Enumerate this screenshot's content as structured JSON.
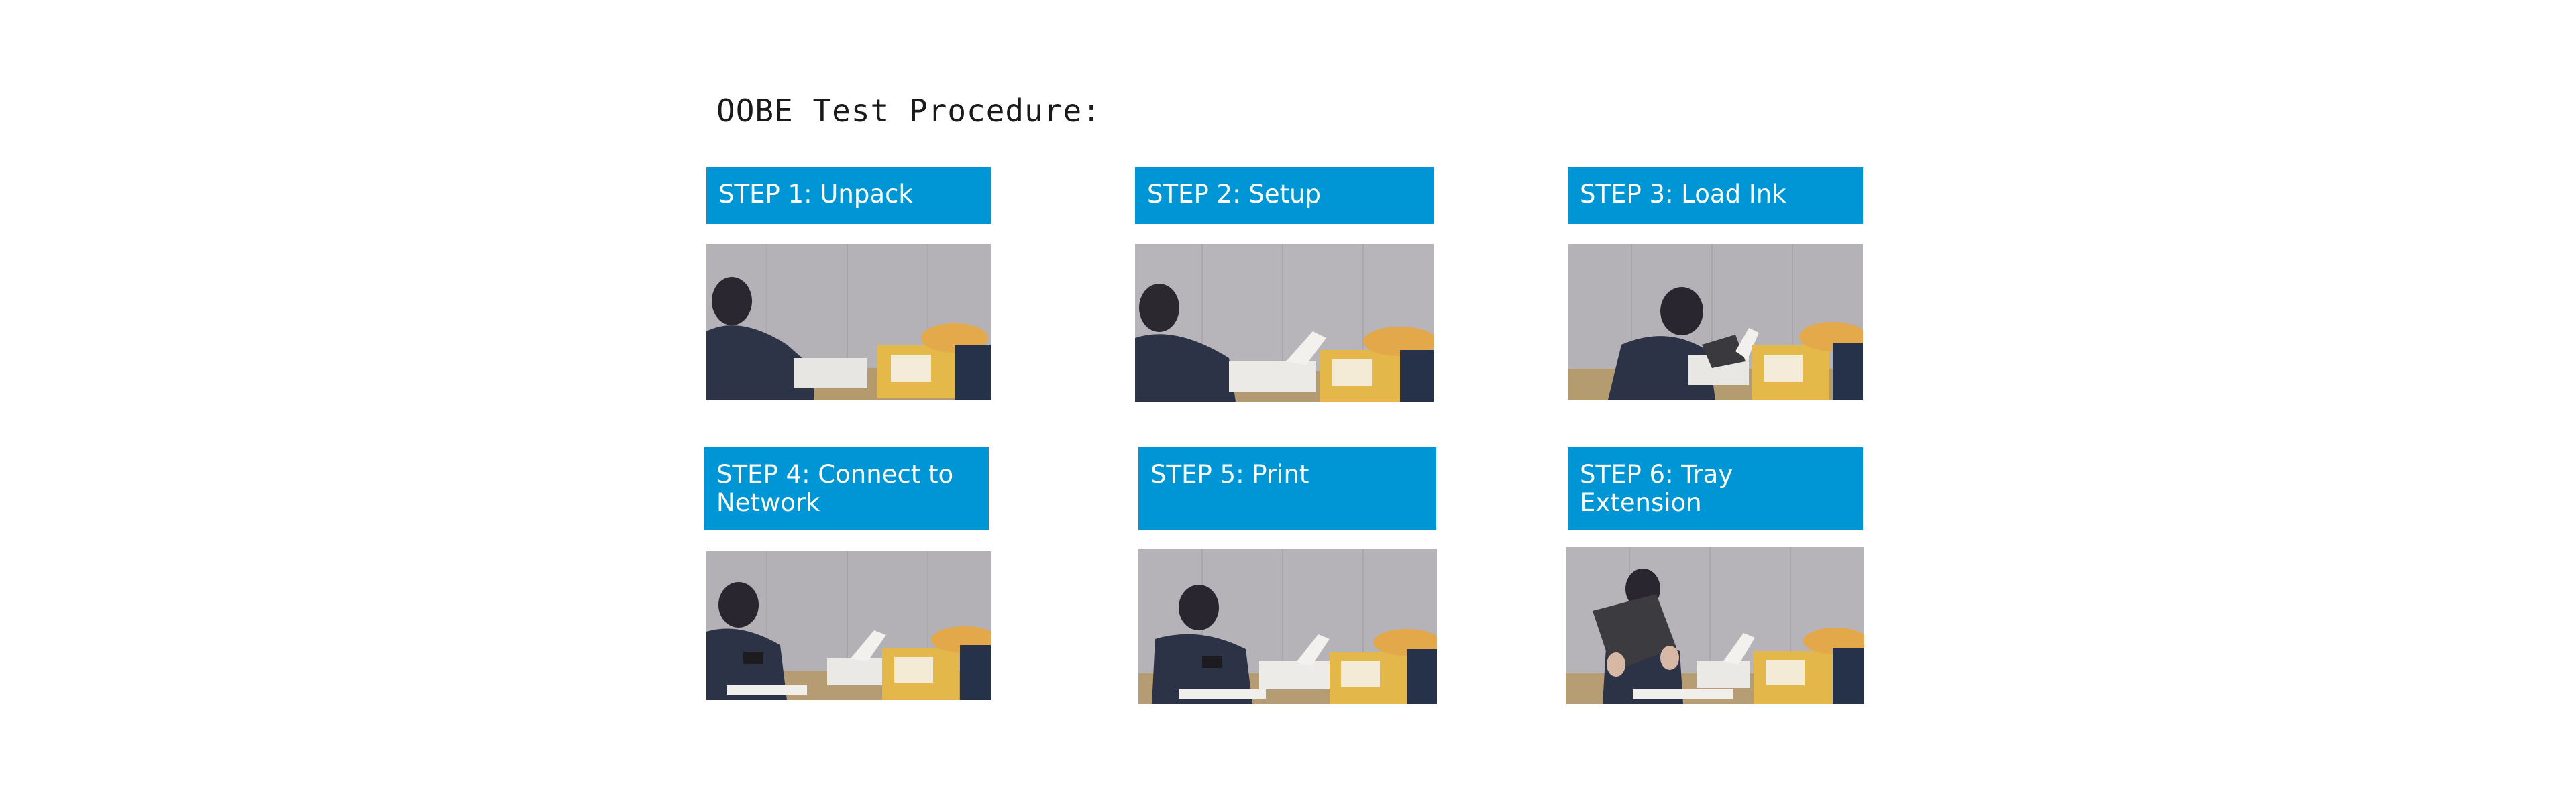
{
  "slide": {
    "title": "OOBE Test Procedure:"
  },
  "steps": [
    {
      "label": "STEP 1: Unpack"
    },
    {
      "label": "STEP 2: Setup"
    },
    {
      "label": "STEP 3: Load Ink"
    },
    {
      "label": "STEP 4: Connect to Network"
    },
    {
      "label": "STEP 5: Print"
    },
    {
      "label": "STEP 6: Tray Extension"
    }
  ],
  "colors": {
    "header_background": "#0096d6",
    "header_text": "#ffffff",
    "title_text": "#1a1a1a"
  }
}
